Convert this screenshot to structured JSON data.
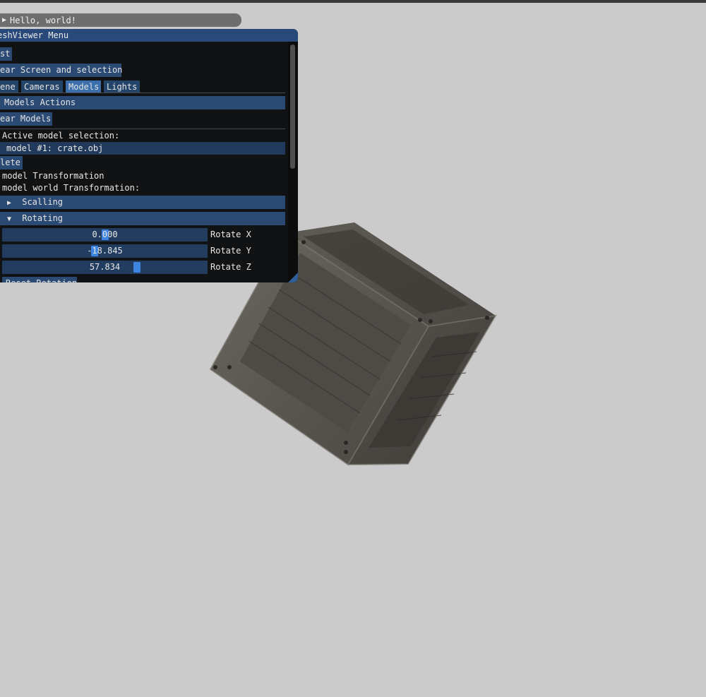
{
  "collapsed_window": {
    "title": "Hello, world!"
  },
  "window": {
    "title": "eshViewer Menu",
    "buttons": {
      "first": "st",
      "clear_screen": "ear Screen and selection",
      "clear_models": "ear Models",
      "delete": "lete",
      "reset_rotation": "Reset Rotation"
    },
    "tabs": [
      {
        "label": "ene",
        "active": false
      },
      {
        "label": "Cameras",
        "active": false
      },
      {
        "label": "Models",
        "active": true
      },
      {
        "label": "Lights",
        "active": false
      }
    ],
    "models_actions_header": "Models Actions",
    "active_selection_label": "Active model selection:",
    "active_selection_value": "model #1: crate.obj",
    "model_transformation": "model Transformation",
    "model_world_transformation": "model world Transformation:",
    "scaling_header": "Scalling",
    "rotating_header": "Rotating",
    "sliders": [
      {
        "value": "0.000",
        "label": "Rotate X",
        "fraction": 0.5
      },
      {
        "value": "-18.845",
        "label": "Rotate Y",
        "fraction": 0.447
      },
      {
        "value": "57.834",
        "label": "Rotate Z",
        "fraction": 0.661
      }
    ]
  },
  "colors": {
    "background": "#cbcbcb",
    "window_bg": "#111214",
    "title_bar": "#29497a",
    "button": "#2a4a73",
    "slider_grab": "#3d85e0"
  }
}
